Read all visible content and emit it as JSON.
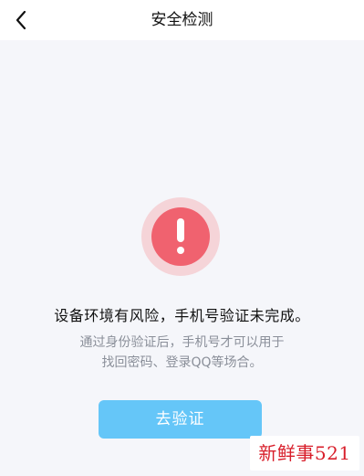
{
  "header": {
    "title": "安全检测"
  },
  "status": {
    "headline": "设备环境有风险，手机号验证未完成。",
    "description_line1": "通过身份验证后，手机号才可以用于",
    "description_line2": "找回密码、登录QQ等场合。"
  },
  "actions": {
    "verify_label": "去验证"
  },
  "watermark": {
    "text": "新鲜事521"
  },
  "colors": {
    "alert_red": "#f0626f",
    "alert_ring": "#f5d4d8",
    "button_blue": "#65c6f8",
    "background": "#f5f6fa"
  },
  "icons": {
    "back": "chevron-left-icon",
    "alert": "exclamation-icon"
  }
}
